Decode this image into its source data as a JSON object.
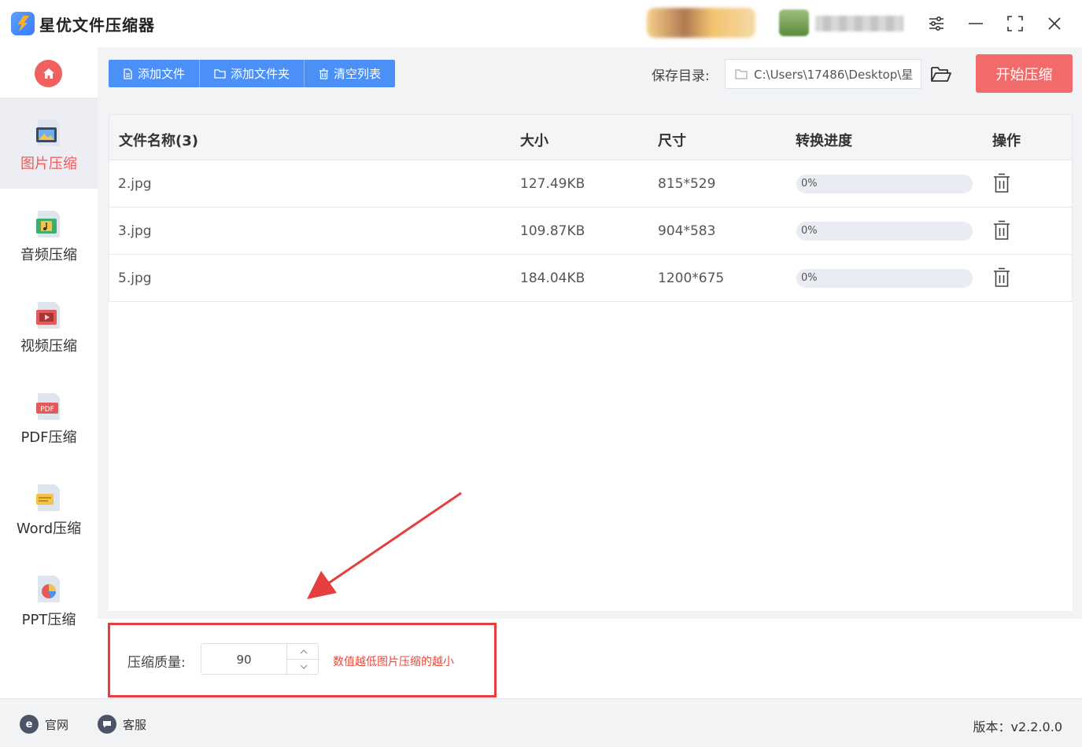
{
  "app": {
    "title": "星优文件压缩器"
  },
  "sidebar": {
    "items": [
      {
        "label": "图片压缩",
        "icon": "image-icon",
        "active": true
      },
      {
        "label": "音频压缩",
        "icon": "music-icon",
        "active": false
      },
      {
        "label": "视频压缩",
        "icon": "video-icon",
        "active": false
      },
      {
        "label": "PDF压缩",
        "icon": "pdf-icon",
        "active": false
      },
      {
        "label": "Word压缩",
        "icon": "word-icon",
        "active": false
      },
      {
        "label": "PPT压缩",
        "icon": "ppt-icon",
        "active": false
      }
    ]
  },
  "toolbar": {
    "add_file": "添加文件",
    "add_folder": "添加文件夹",
    "clear_list": "清空列表",
    "save_label": "保存目录:",
    "save_path": "C:\\Users\\17486\\Desktop\\星",
    "start": "开始压缩"
  },
  "table": {
    "headers": {
      "name": "文件名称(3)",
      "size": "大小",
      "dimensions": "尺寸",
      "progress": "转换进度",
      "action": "操作"
    },
    "rows": [
      {
        "name": "2.jpg",
        "size": "127.49KB",
        "dimensions": "815*529",
        "progress_text": "0%",
        "progress": 0
      },
      {
        "name": "3.jpg",
        "size": "109.87KB",
        "dimensions": "904*583",
        "progress_text": "0%",
        "progress": 0
      },
      {
        "name": "5.jpg",
        "size": "184.04KB",
        "dimensions": "1200*675",
        "progress_text": "0%",
        "progress": 0
      }
    ]
  },
  "settings": {
    "quality_label": "压缩质量:",
    "quality_value": "90",
    "quality_hint": "数值越低图片压缩的越小"
  },
  "footer": {
    "website": "官网",
    "support": "客服",
    "version": "版本：v2.2.0.0"
  },
  "colors": {
    "accent_blue": "#4a90f7",
    "accent_red": "#f26b6b",
    "highlight_red": "#e53e3e"
  }
}
